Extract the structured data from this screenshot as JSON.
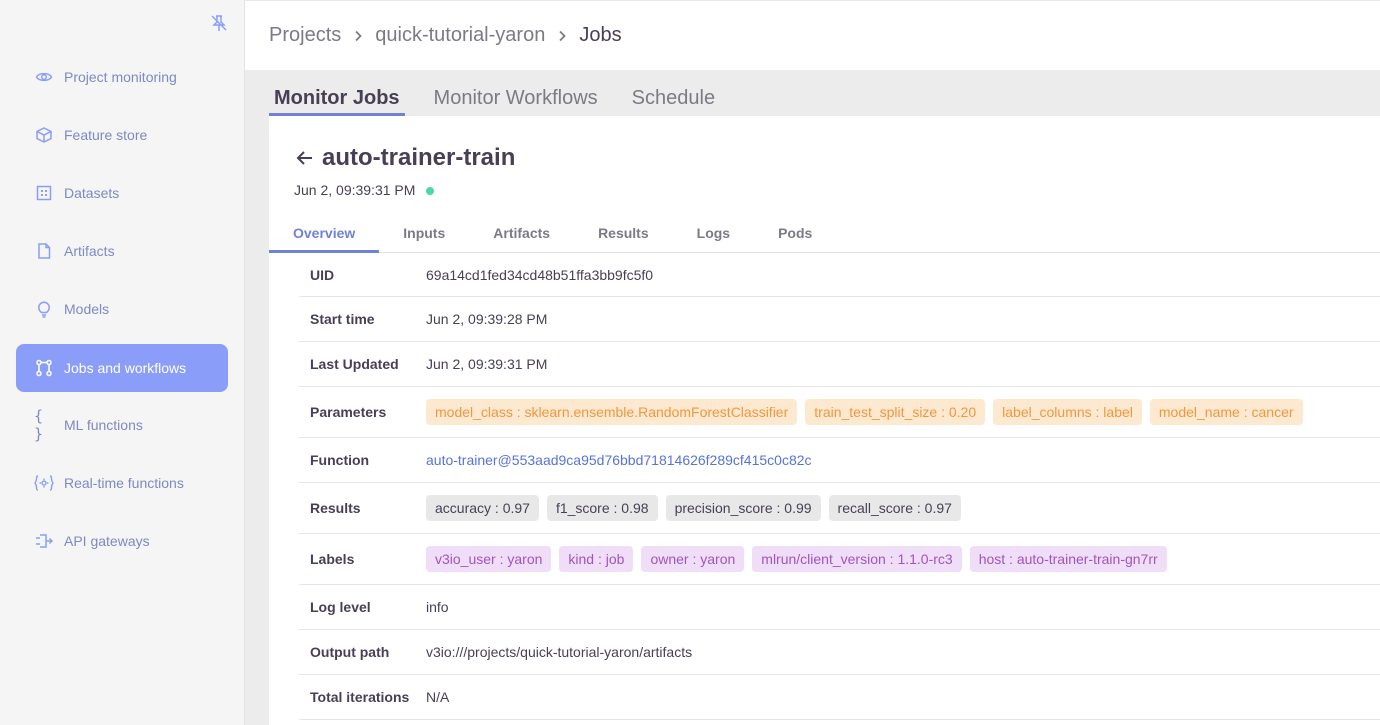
{
  "sidebar": {
    "items": [
      {
        "label": "Project monitoring",
        "icon": "eye-icon"
      },
      {
        "label": "Feature store",
        "icon": "cube-icon"
      },
      {
        "label": "Datasets",
        "icon": "grid-icon"
      },
      {
        "label": "Artifacts",
        "icon": "file-icon"
      },
      {
        "label": "Models",
        "icon": "lightbulb-icon"
      },
      {
        "label": "Jobs and workflows",
        "icon": "workflow-icon",
        "active": true
      },
      {
        "label": "ML functions",
        "icon": "braces-icon"
      },
      {
        "label": "Real-time functions",
        "icon": "gear-braces-icon"
      },
      {
        "label": "API gateways",
        "icon": "api-gateway-icon"
      }
    ]
  },
  "breadcrumbs": [
    "Projects",
    "quick-tutorial-yaron",
    "Jobs"
  ],
  "top_tabs": [
    "Monitor Jobs",
    "Monitor Workflows",
    "Schedule"
  ],
  "job": {
    "title": "auto-trainer-train",
    "date": "Jun 2, 09:39:31 PM",
    "status_color": "#49d8a8"
  },
  "detail_tabs": [
    "Overview",
    "Inputs",
    "Artifacts",
    "Results",
    "Logs",
    "Pods"
  ],
  "details": {
    "uid": {
      "label": "UID",
      "value": "69a14cd1fed34cd48b51ffa3bb9fc5f0"
    },
    "start_time": {
      "label": "Start time",
      "value": "Jun 2, 09:39:28 PM"
    },
    "last_updated": {
      "label": "Last Updated",
      "value": "Jun 2, 09:39:31 PM"
    },
    "parameters": {
      "label": "Parameters",
      "chips": [
        "model_class : sklearn.ensemble.RandomForestClassifier",
        "train_test_split_size : 0.20",
        "label_columns : label",
        "model_name : cancer"
      ]
    },
    "function": {
      "label": "Function",
      "value": "auto-trainer@553aad9ca95d76bbd71814626f289cf415c0c82c"
    },
    "results": {
      "label": "Results",
      "chips": [
        "accuracy : 0.97",
        "f1_score : 0.98",
        "precision_score : 0.99",
        "recall_score : 0.97"
      ]
    },
    "labels": {
      "label": "Labels",
      "chips": [
        "v3io_user : yaron",
        "kind : job",
        "owner : yaron",
        "mlrun/client_version : 1.1.0-rc3",
        "host : auto-trainer-train-gn7rr"
      ]
    },
    "log_level": {
      "label": "Log level",
      "value": "info"
    },
    "output_path": {
      "label": "Output path",
      "value": "v3io:///projects/quick-tutorial-yaron/artifacts"
    },
    "total_iterations": {
      "label": "Total iterations",
      "value": "N/A"
    }
  },
  "colors": {
    "accent": "#6f82d8",
    "sidebar_active": "#8a9ef9",
    "param_chip": "#fde9cf",
    "label_chip": "#f0ddf7"
  }
}
